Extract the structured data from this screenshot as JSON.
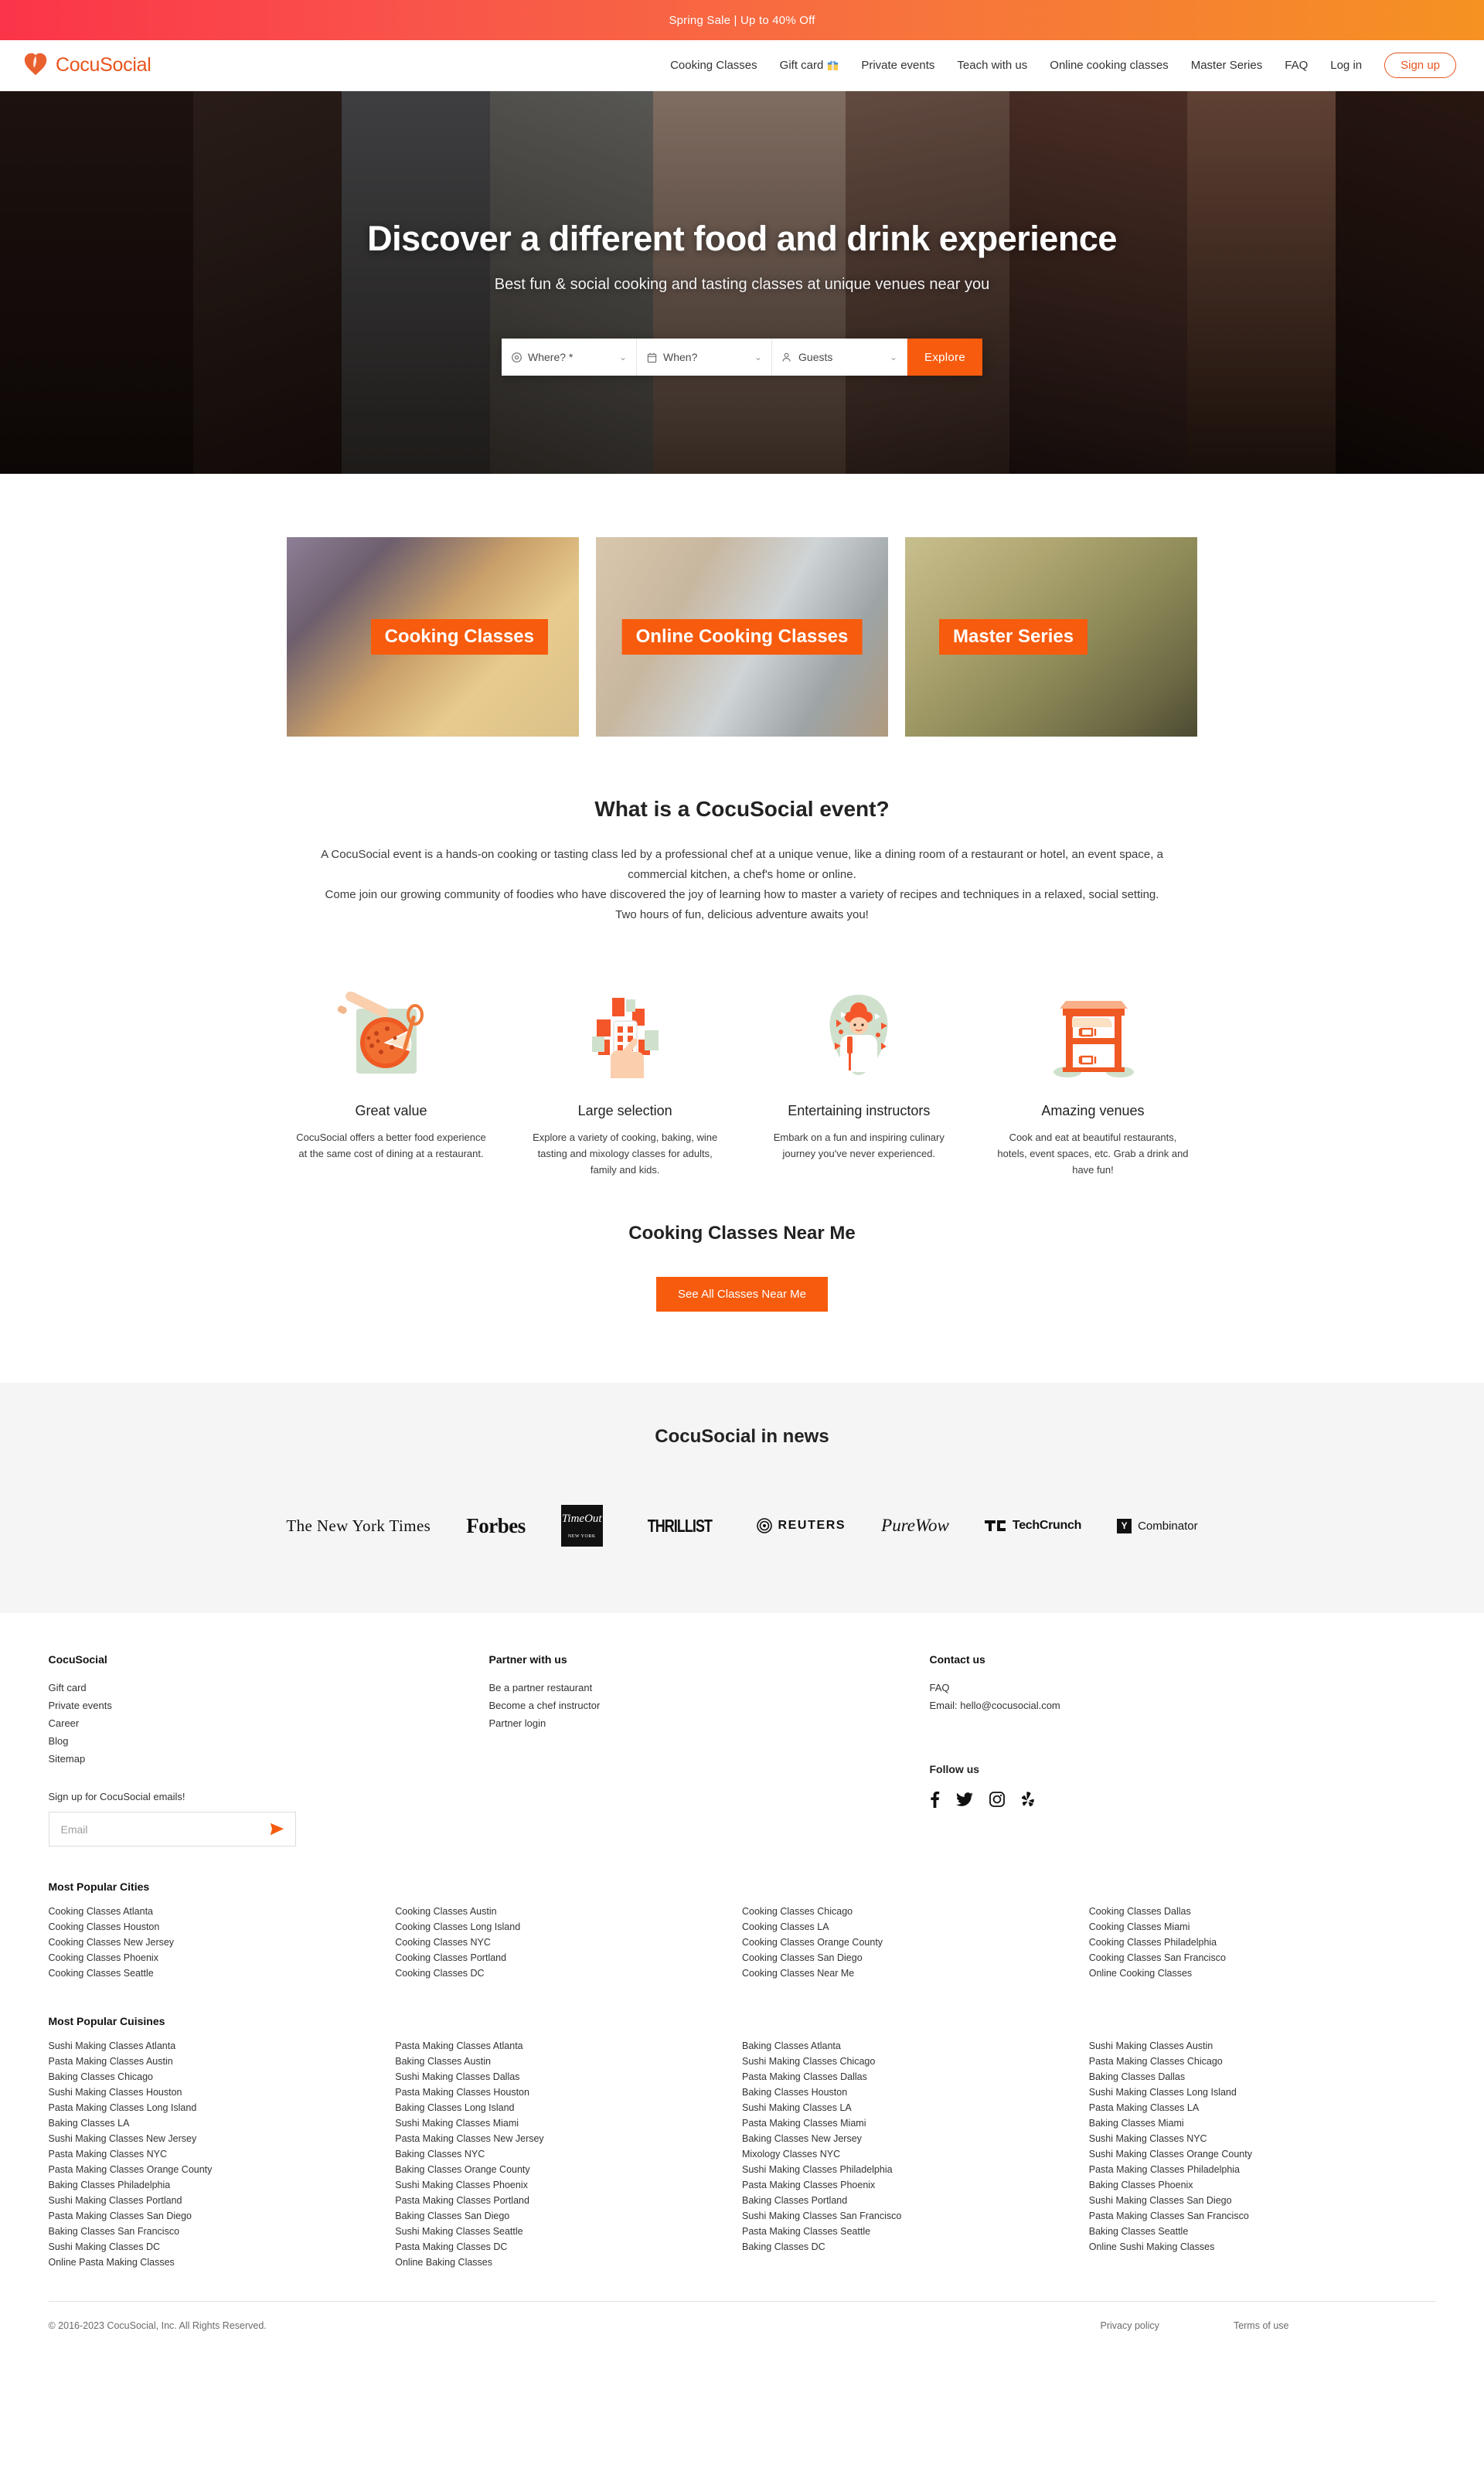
{
  "promo": {
    "text": "Spring Sale | Up to 40% Off"
  },
  "header": {
    "brand": "CocuSocial",
    "nav": [
      {
        "label": "Cooking Classes",
        "icon": null
      },
      {
        "label": "Gift card",
        "icon": "gift-icon"
      },
      {
        "label": "Private events",
        "icon": null
      },
      {
        "label": "Teach with us",
        "icon": null
      },
      {
        "label": "Online cooking classes",
        "icon": null
      },
      {
        "label": "Master Series",
        "icon": null
      },
      {
        "label": "FAQ",
        "icon": null
      },
      {
        "label": "Log in",
        "icon": null
      }
    ],
    "signup": "Sign up"
  },
  "hero": {
    "title": "Discover a different food and drink experience",
    "subtitle": "Best fun & social cooking and tasting classes at unique venues near you",
    "search": {
      "where_label": "Where? *",
      "when_label": "When?",
      "guests_label": "Guests",
      "explore": "Explore"
    }
  },
  "cards": [
    {
      "label": "Cooking Classes"
    },
    {
      "label": "Online Cooking Classes"
    },
    {
      "label": "Master Series"
    }
  ],
  "what": {
    "heading": "What is a CocuSocial event?",
    "para1": "A CocuSocial event is a hands-on cooking or tasting class led by a professional chef at a unique venue, like a dining room of a restaurant or hotel, an event space, a commercial kitchen, a chef's home or online.",
    "para2": "Come join our growing community of foodies who have discovered the joy of learning how to master a variety of recipes and techniques in a relaxed, social setting. Two hours of fun, delicious adventure awaits you!"
  },
  "features": [
    {
      "icon": "pizza-rolling-pin-icon",
      "title": "Great value",
      "text": "CocuSocial offers a better food experience at the same cost of dining at a restaurant."
    },
    {
      "icon": "phone-selection-icon",
      "title": "Large selection",
      "text": "Explore a variety of cooking, baking, wine tasting and mixology classes for adults, family and kids."
    },
    {
      "icon": "chef-icon",
      "title": "Entertaining instructors",
      "text": "Embark on a fun and inspiring culinary journey you've never experienced."
    },
    {
      "icon": "restaurant-building-icon",
      "title": "Amazing venues",
      "text": "Cook and eat at beautiful restaurants, hotels, event spaces, etc. Grab a drink and have fun!"
    }
  ],
  "nearme": {
    "heading": "Cooking Classes Near Me",
    "button": "See All Classes Near Me"
  },
  "news": {
    "heading": "CocuSocial in news",
    "logos": [
      {
        "name": "the-new-york-times-logo",
        "text": "The New York Times"
      },
      {
        "name": "forbes-logo",
        "text": "Forbes"
      },
      {
        "name": "timeout-logo",
        "text": "TimeOut",
        "sub": "NEW YORK"
      },
      {
        "name": "thrillist-logo",
        "text": "THRILLIST"
      },
      {
        "name": "reuters-logo",
        "text": "REUTERS"
      },
      {
        "name": "purewow-logo",
        "text": "PureWow"
      },
      {
        "name": "techcrunch-logo",
        "text": "TechCrunch"
      },
      {
        "name": "y-combinator-logo",
        "text": "Combinator",
        "badge": "Y"
      }
    ]
  },
  "footer": {
    "col1": {
      "heading": "CocuSocial",
      "links": [
        "Gift card",
        "Private events",
        "Career",
        "Blog",
        "Sitemap"
      ],
      "newsletter_label": "Sign up for CocuSocial emails!",
      "email_placeholder": "Email",
      "email_value": ""
    },
    "col2": {
      "heading": "Partner with us",
      "links": [
        "Be a partner restaurant",
        "Become a chef instructor",
        "Partner login"
      ]
    },
    "col3": {
      "heading": "Contact us",
      "links": [
        "FAQ",
        "Email: hello@cocusocial.com"
      ],
      "follow_heading": "Follow us",
      "socials": [
        "facebook-icon",
        "twitter-icon",
        "instagram-icon",
        "yelp-icon"
      ]
    },
    "cities": {
      "heading": "Most Popular Cities",
      "columns": [
        [
          "Cooking Classes Atlanta",
          "Cooking Classes Houston",
          "Cooking Classes New Jersey",
          "Cooking Classes Phoenix",
          "Cooking Classes Seattle"
        ],
        [
          "Cooking Classes Austin",
          "Cooking Classes Long Island",
          "Cooking Classes NYC",
          "Cooking Classes Portland",
          "Cooking Classes DC"
        ],
        [
          "Cooking Classes Chicago",
          "Cooking Classes LA",
          "Cooking Classes Orange County",
          "Cooking Classes San Diego",
          "Cooking Classes Near Me"
        ],
        [
          "Cooking Classes Dallas",
          "Cooking Classes Miami",
          "Cooking Classes Philadelphia",
          "Cooking Classes San Francisco",
          "Online Cooking Classes"
        ]
      ]
    },
    "cuisines": {
      "heading": "Most Popular Cuisines",
      "columns": [
        [
          "Sushi Making Classes Atlanta",
          "Pasta Making Classes Austin",
          "Baking Classes Chicago",
          "Sushi Making Classes Houston",
          "Pasta Making Classes Long Island",
          "Baking Classes LA",
          "Sushi Making Classes New Jersey",
          "Pasta Making Classes NYC",
          "Pasta Making Classes Orange County",
          "Baking Classes Philadelphia",
          "Sushi Making Classes Portland",
          "Pasta Making Classes San Diego",
          "Baking Classes San Francisco",
          "Sushi Making Classes DC",
          "Online Pasta Making Classes"
        ],
        [
          "Pasta Making Classes Atlanta",
          "Baking Classes Austin",
          "Sushi Making Classes Dallas",
          "Pasta Making Classes Houston",
          "Baking Classes Long Island",
          "Sushi Making Classes Miami",
          "Pasta Making Classes New Jersey",
          "Baking Classes NYC",
          "Baking Classes Orange County",
          "Sushi Making Classes Phoenix",
          "Pasta Making Classes Portland",
          "Baking Classes San Diego",
          "Sushi Making Classes Seattle",
          "Pasta Making Classes DC",
          "Online Baking Classes"
        ],
        [
          "Baking Classes Atlanta",
          "Sushi Making Classes Chicago",
          "Pasta Making Classes Dallas",
          "Baking Classes Houston",
          "Sushi Making Classes LA",
          "Pasta Making Classes Miami",
          "Baking Classes New Jersey",
          "Mixology Classes NYC",
          "Sushi Making Classes Philadelphia",
          "Pasta Making Classes Phoenix",
          "Baking Classes Portland",
          "Sushi Making Classes San Francisco",
          "Pasta Making Classes Seattle",
          "Baking Classes DC"
        ],
        [
          "Sushi Making Classes Austin",
          "Pasta Making Classes Chicago",
          "Baking Classes Dallas",
          "Sushi Making Classes Long Island",
          "Pasta Making Classes LA",
          "Baking Classes Miami",
          "Sushi Making Classes NYC",
          "Sushi Making Classes Orange County",
          "Pasta Making Classes Philadelphia",
          "Baking Classes Phoenix",
          "Sushi Making Classes San Diego",
          "Pasta Making Classes San Francisco",
          "Baking Classes Seattle",
          "Online Sushi Making Classes"
        ]
      ]
    },
    "bottom": {
      "copyright": "© 2016-2023 CocuSocial, Inc. All Rights Reserved.",
      "privacy": "Privacy policy",
      "terms": "Terms of use"
    }
  },
  "colors": {
    "accent": "#f75b0d",
    "brand": "#e8541e",
    "promo_from": "#fb3449",
    "promo_to": "#f59222"
  }
}
